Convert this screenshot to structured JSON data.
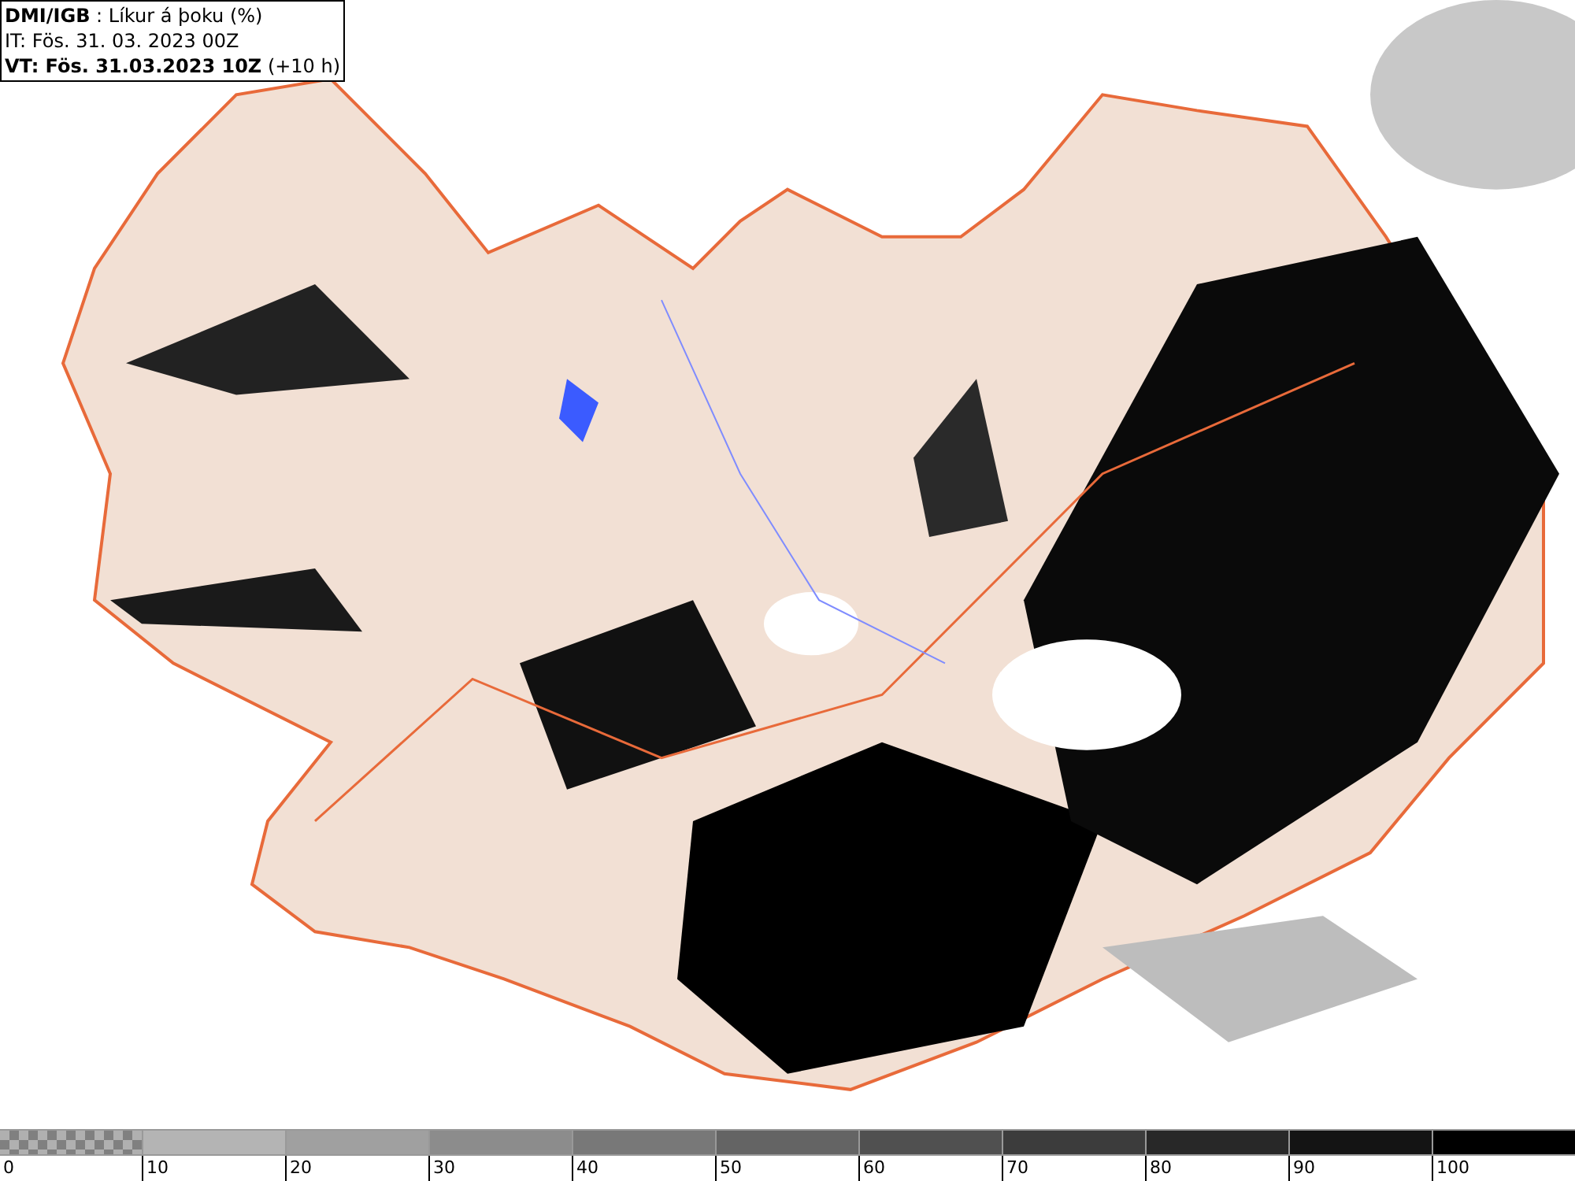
{
  "header": {
    "lines": [
      "**DMI/IGB** : Líkur á þoku (%)",
      "IT: Fös. 31. 03. 2023 00Z",
      "**VT: Fös. 31.03.2023 10Z** (+10 h)"
    ]
  },
  "legend": {
    "bins": [
      {
        "kind": "checker",
        "color": "#808080",
        "label": "0"
      },
      {
        "kind": "solid",
        "color": "#b4b4b4",
        "label": "10"
      },
      {
        "kind": "solid",
        "color": "#a0a0a0",
        "label": "20"
      },
      {
        "kind": "solid",
        "color": "#8c8c8c",
        "label": "30"
      },
      {
        "kind": "solid",
        "color": "#787878",
        "label": "40"
      },
      {
        "kind": "solid",
        "color": "#646464",
        "label": "50"
      },
      {
        "kind": "solid",
        "color": "#505050",
        "label": "60"
      },
      {
        "kind": "solid",
        "color": "#3c3c3c",
        "label": "70"
      },
      {
        "kind": "solid",
        "color": "#282828",
        "label": "80"
      },
      {
        "kind": "solid",
        "color": "#141414",
        "label": "90"
      },
      {
        "kind": "solid",
        "color": "#000000",
        "label": "100"
      }
    ]
  }
}
